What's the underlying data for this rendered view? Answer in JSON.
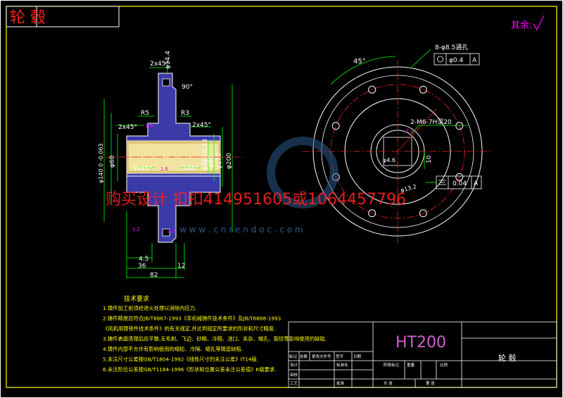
{
  "title_tab": {
    "label": "轮 毂"
  },
  "roughness_note": {
    "label": "其余:"
  },
  "watermark": {
    "text": "购买设计 扣扣414951605或1064457796",
    "site": "w w w . c n r e n d o c . c o m"
  },
  "front_view": {
    "dims": {
      "chamfer_top": "2x45°",
      "dia_144": "φ14.4",
      "angle_90": "90°",
      "r5": "R5",
      "r3": "R3",
      "chamfer_left": "2x45°",
      "chamfer_right": "2x45°",
      "rough_left": "1.6",
      "dia_140": "φ140 0 -0.063",
      "dia_60": "φ60",
      "dia_38": "φ38+0.43",
      "dia_60b": "φ60",
      "dia_170": "φ170",
      "dia_200": "φ200",
      "chamfer_in_left": "1x45°",
      "chamfer_in_right": "1x45°",
      "rough_in": "1.6",
      "rough_bottom": "3.2",
      "rough_bottom2": "3.2",
      "len_45": "4.5",
      "len_36": "36",
      "len_12": "12",
      "len_82": "82"
    }
  },
  "side_view": {
    "angle_45": "45°",
    "holes_spec": "8-φ8.5通孔",
    "pos_tol": "φ0.4",
    "datum_a1": "A",
    "tap_spec": "2-M6-7H深20",
    "rough_side": "3.2",
    "key_dim": "φ13.2",
    "key_w": "10",
    "key_d": "φ4.6",
    "sym_tol": "0.04",
    "datum_a2": "A"
  },
  "tech_req": {
    "title": "技术要求",
    "lines": [
      "1.铸件加工前须经退火处理以消除内应力.",
      "2.铸件精度应符合JB/T6887-1993《非机械铸件技术条件》及JB/T6888-1993",
      "《风机用铸铁件技术条件》的有关规定,并达到规定所要求的形状和尺寸精度.",
      "3.铸件表面清理后应平整,无毛刺、飞边、砂眼、冷隔、浇口、夹杂、缩孔、裂纹等影响使用的缺陷.",
      "4.铸件内部不允许有影响使用的缩松、冷隔、缩孔等铸造缺陷.",
      "5.未注尺寸公差按GB/T1804-1992《线性尺寸的未注公差》IT14级.",
      "6.未注形位公差按GB/T1184-1996《形状和位置公差未注公差值》K级要求."
    ]
  },
  "title_block": {
    "material": "HT200",
    "part_name": "轮 毂",
    "headers_left": [
      "标记",
      "处数",
      "更改文件号",
      "签字",
      "日期"
    ],
    "row_design": "设计",
    "row_standard": "标准化",
    "row_check": "审核",
    "row_process": "工艺",
    "row_approve": "批准",
    "stage_label": "阶段标记",
    "weight_label": "重量",
    "scale_label": "比例",
    "sheet_label": "共 张",
    "sheet2_label": "第 张",
    "date_label": "日期"
  },
  "colors": {
    "frame": "#ffff00",
    "part_fill": "#3a3aa8",
    "part_edge": "#ffffff",
    "dim": "#00ff00",
    "centerline": "#ff2020",
    "title": "#ff2020",
    "material": "#d060d0",
    "rough": "#ff00ff",
    "text": "#ffffff"
  }
}
